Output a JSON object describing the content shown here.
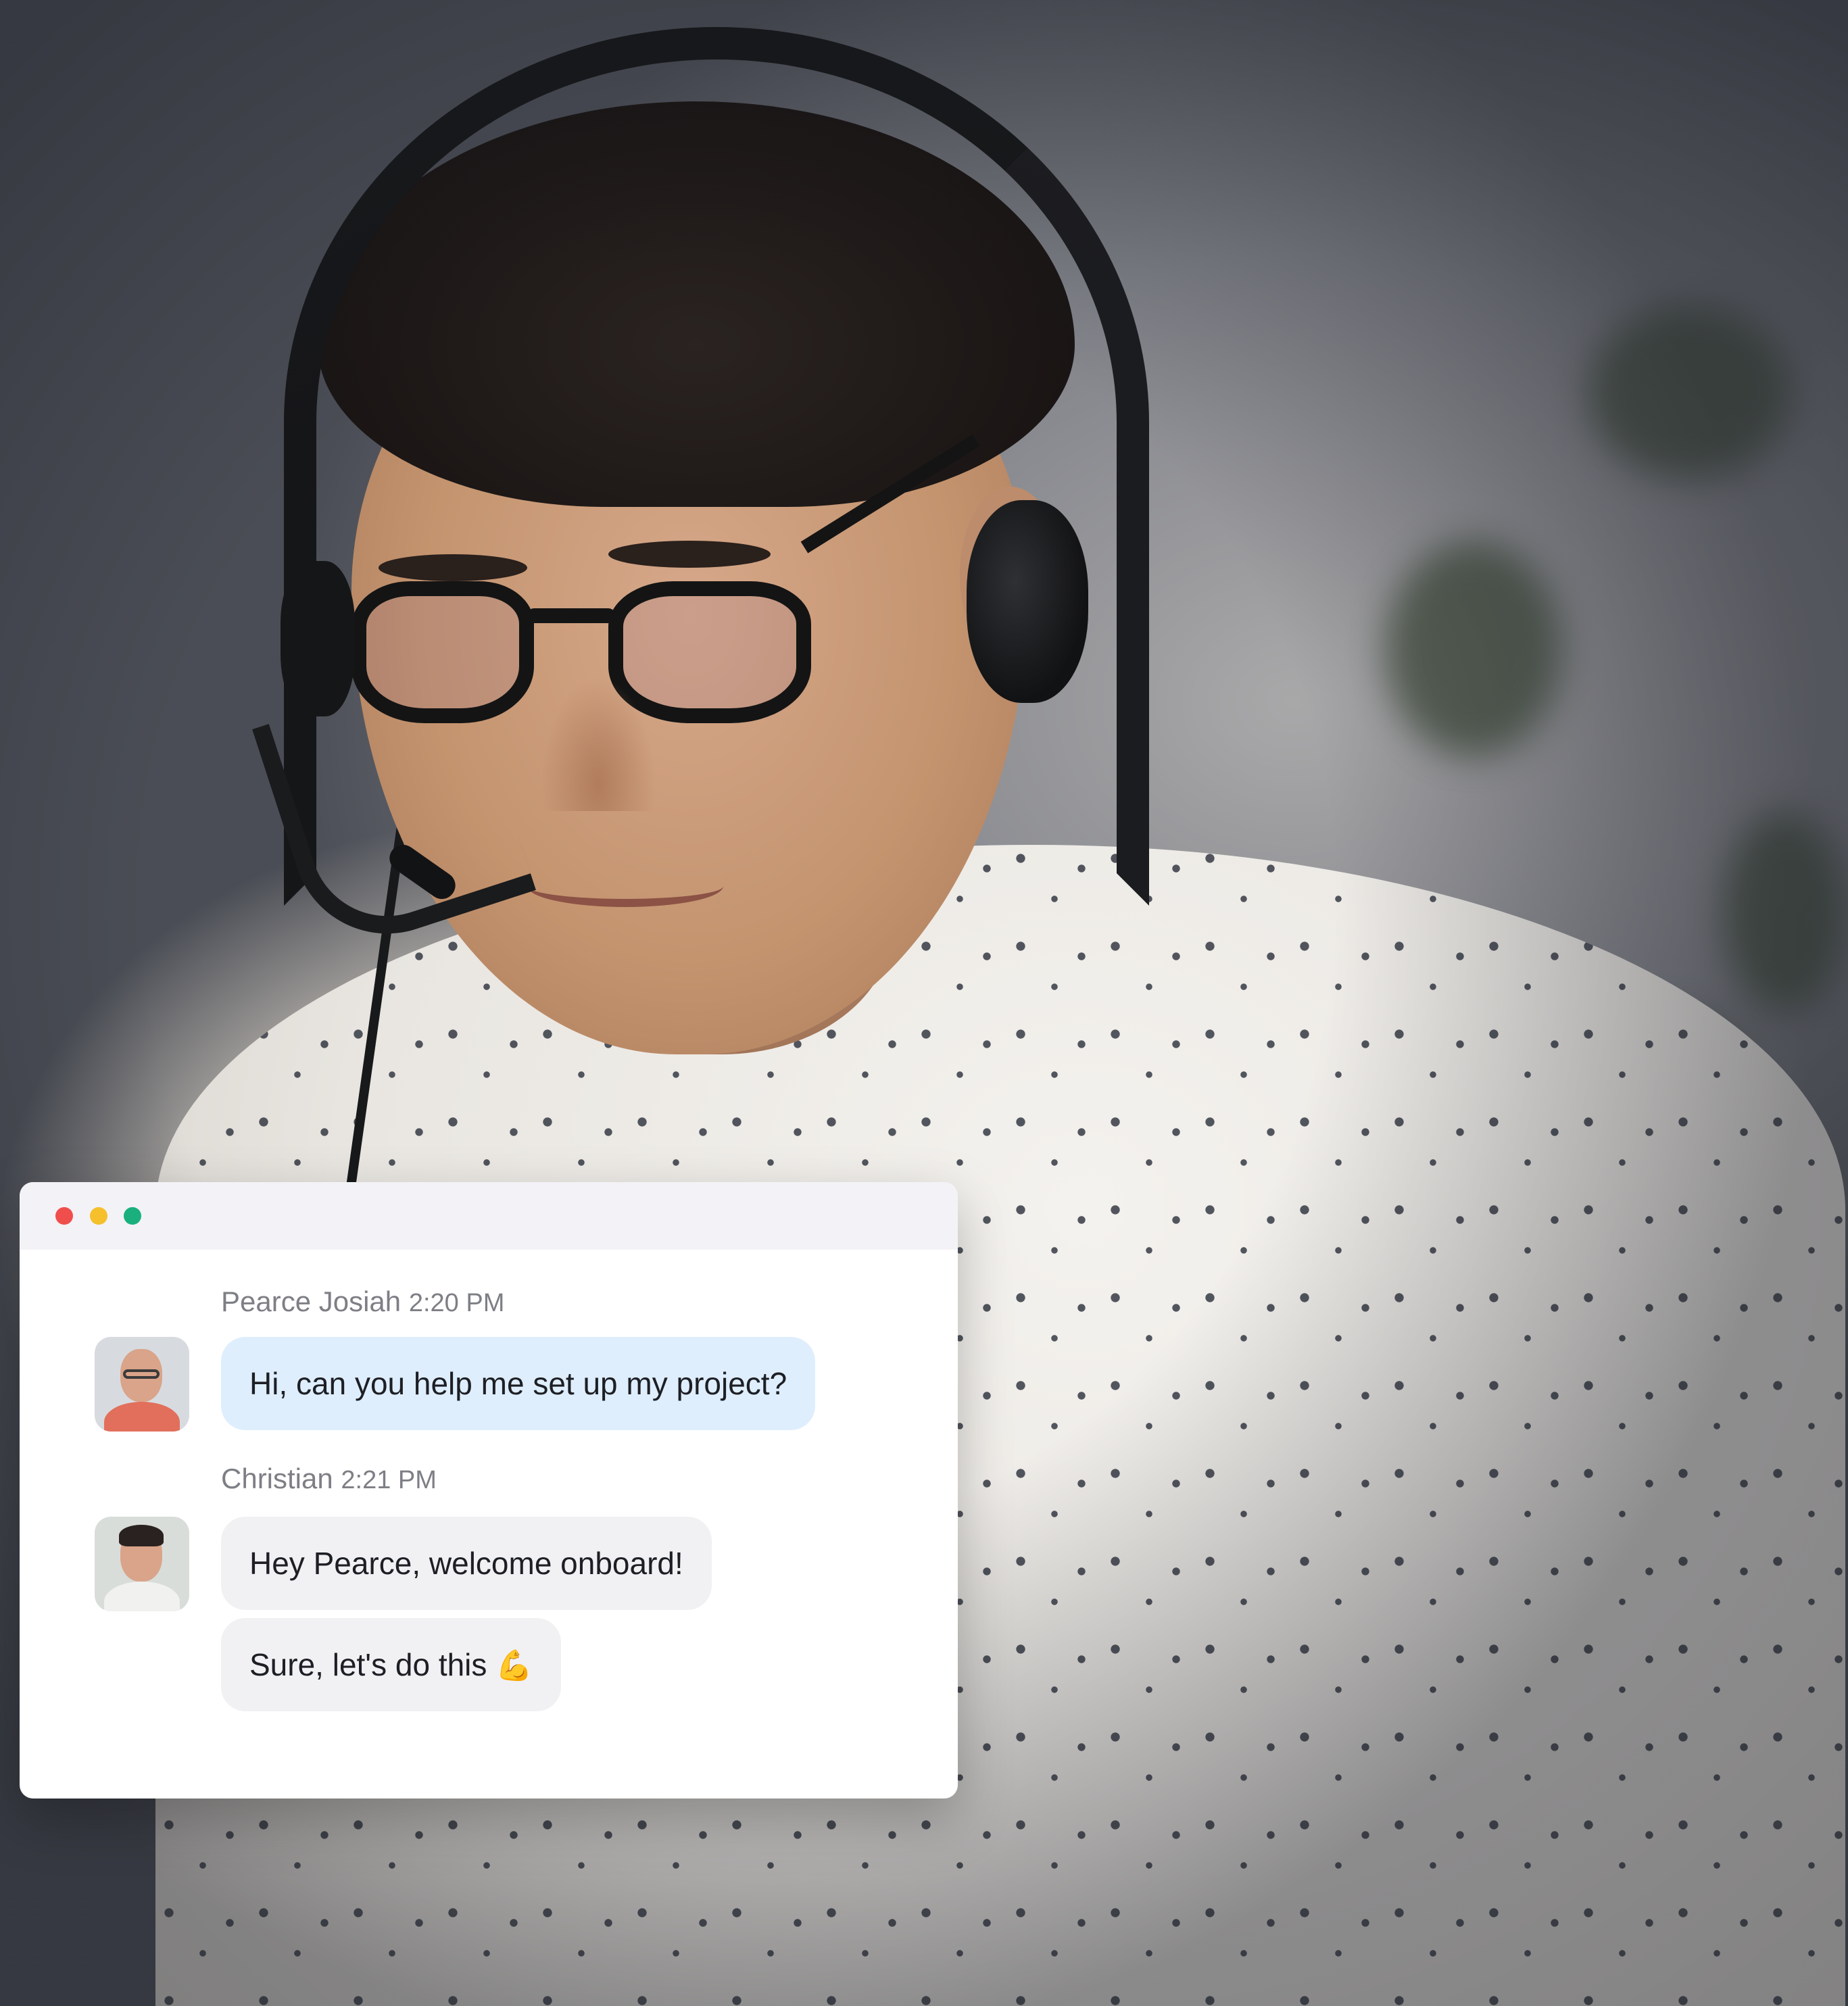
{
  "chat": {
    "window_controls": [
      "close",
      "minimize",
      "maximize"
    ],
    "messages": [
      {
        "sender": "Pearce Josiah",
        "time": "2:20 PM",
        "avatar": "avatar-pearce",
        "texts": [
          "Hi, can you help me set up my project?"
        ]
      },
      {
        "sender": "Christian",
        "time": "2:21 PM",
        "avatar": "avatar-christian",
        "texts": [
          "Hey Pearce, welcome onboard!",
          "Sure, let's do this"
        ],
        "emoji": "💪"
      }
    ]
  },
  "colors": {
    "close": "#f04e4c",
    "minimize": "#f5c02b",
    "maximize": "#19b07d",
    "incoming_bubble": "#dfeefd",
    "outgoing_bubble": "#f1f1f4"
  }
}
